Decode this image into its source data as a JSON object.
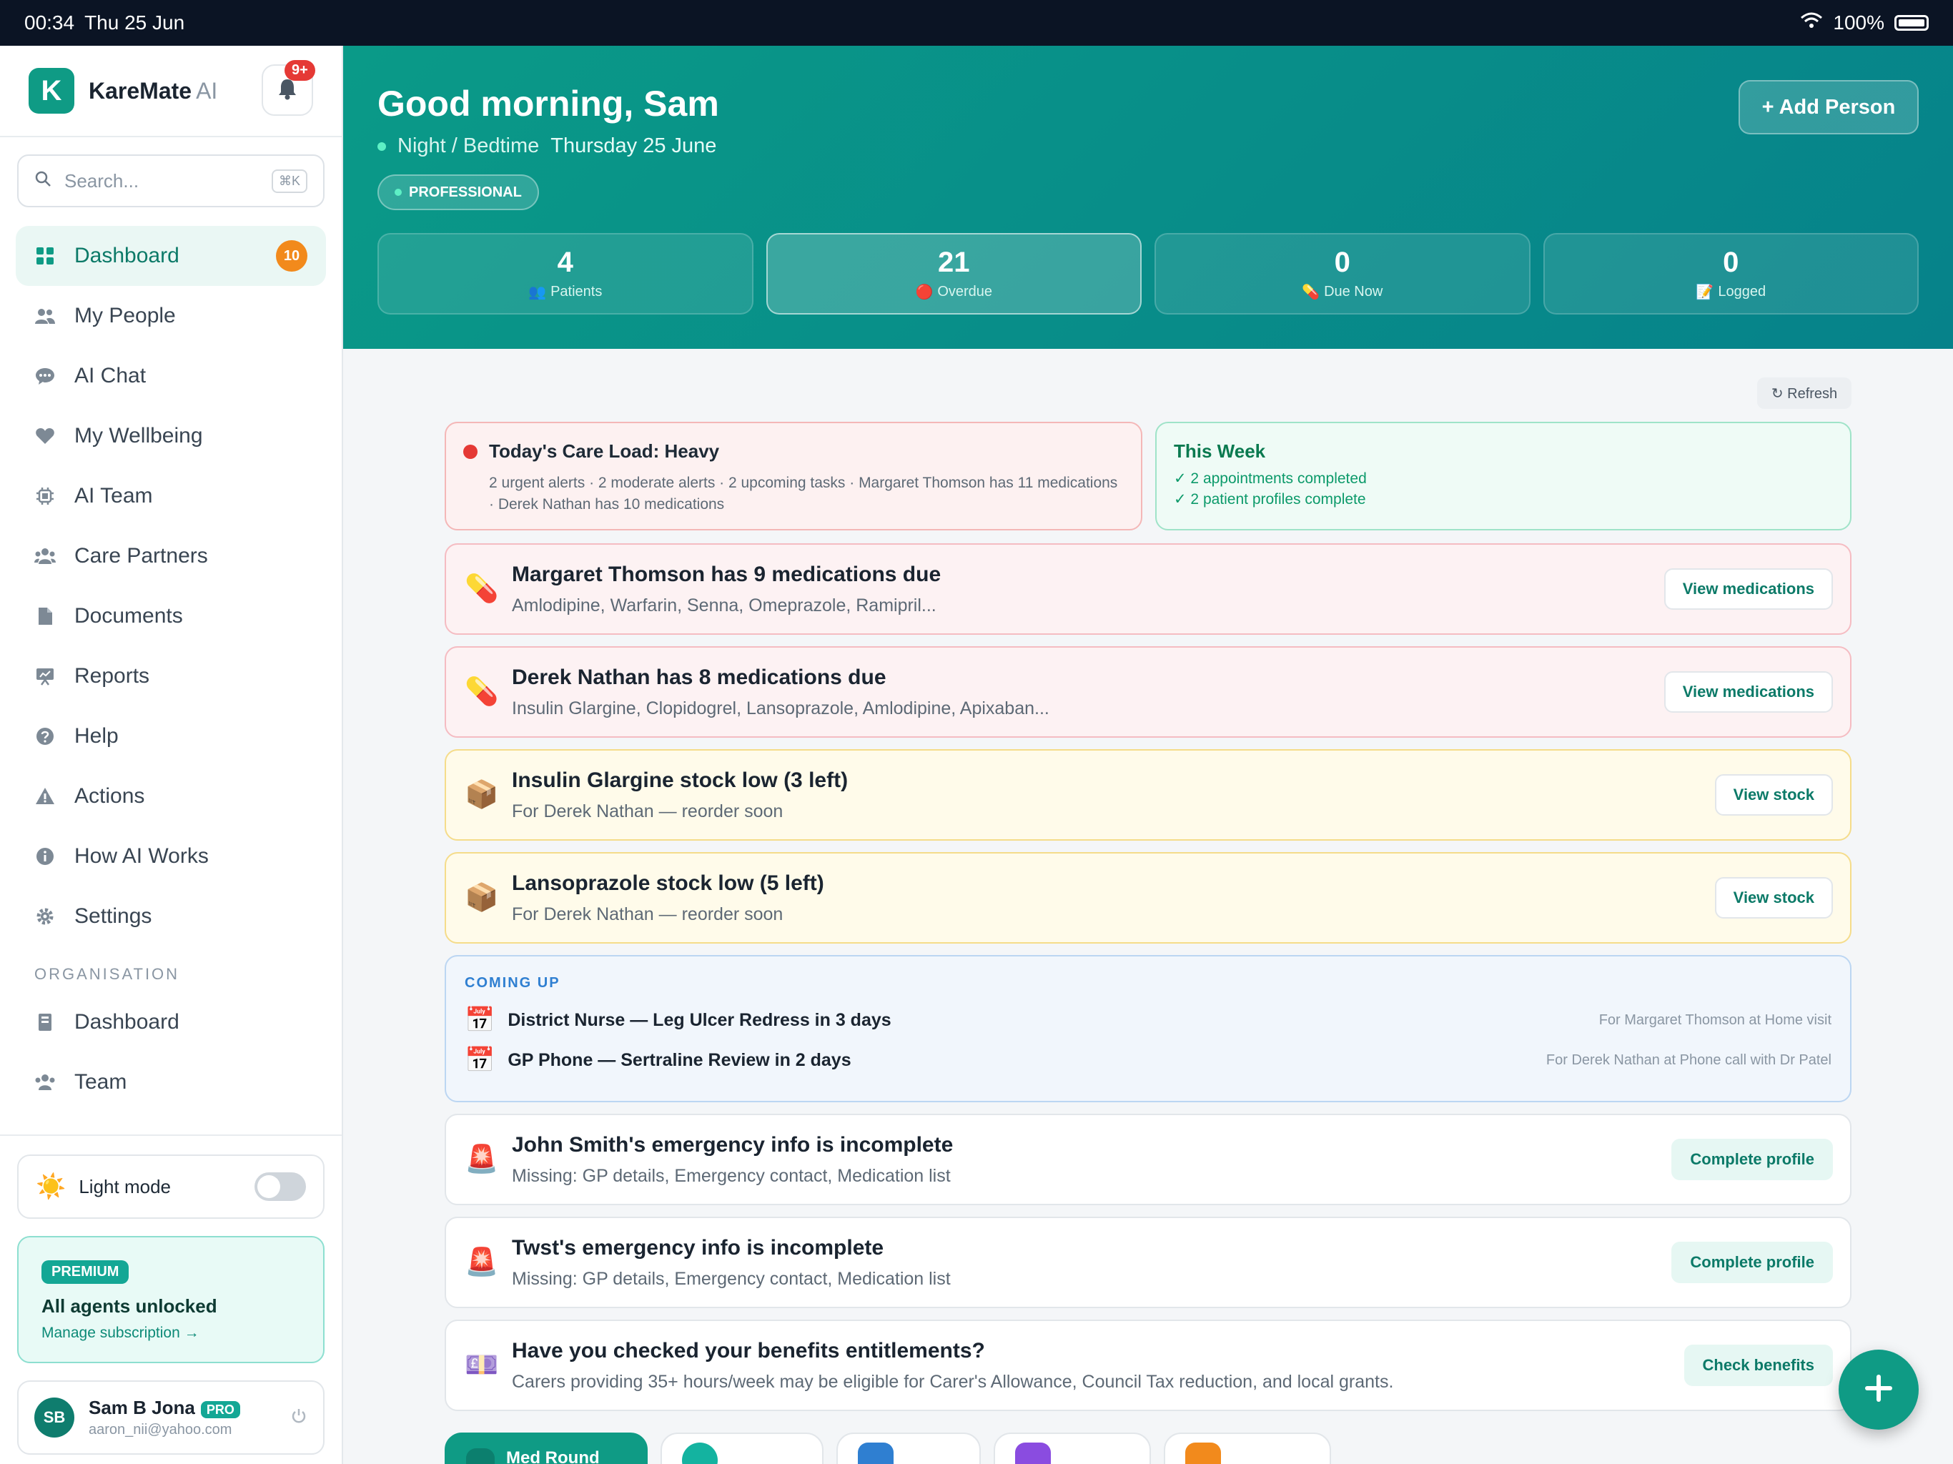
{
  "status_bar": {
    "time": "00:34",
    "date": "Thu 25 Jun",
    "battery": "100%"
  },
  "brand": {
    "name": "KareMate",
    "suffix": "AI",
    "logo_letter": "K",
    "notifications": "9+"
  },
  "search": {
    "placeholder": "Search...",
    "shortcut": "⌘K"
  },
  "nav": {
    "items": [
      {
        "label": "Dashboard",
        "icon": "grid-icon",
        "badge": "10"
      },
      {
        "label": "My People",
        "icon": "people-icon"
      },
      {
        "label": "AI Chat",
        "icon": "chat-icon"
      },
      {
        "label": "My Wellbeing",
        "icon": "heart-icon"
      },
      {
        "label": "AI Team",
        "icon": "chip-icon"
      },
      {
        "label": "Care Partners",
        "icon": "group-icon"
      },
      {
        "label": "Documents",
        "icon": "document-icon"
      },
      {
        "label": "Reports",
        "icon": "presentation-icon"
      },
      {
        "label": "Help",
        "icon": "question-icon"
      },
      {
        "label": "Actions",
        "icon": "warning-icon"
      },
      {
        "label": "How AI Works",
        "icon": "info-icon"
      },
      {
        "label": "Settings",
        "icon": "gear-icon"
      }
    ],
    "org_section": "ORGANISATION",
    "org_items": [
      {
        "label": "Dashboard",
        "icon": "building-icon"
      },
      {
        "label": "Team",
        "icon": "group-icon"
      }
    ]
  },
  "sidebar_footer": {
    "light_mode": "Light mode",
    "light_mode_on": false,
    "premium_badge": "PREMIUM",
    "premium_title": "All agents unlocked",
    "premium_link": "Manage subscription →",
    "user_initials": "SB",
    "user_name": "Sam B Jona",
    "user_badge": "PRO",
    "user_email": "aaron_nii@yahoo.com"
  },
  "header": {
    "greeting": "Good morning, Sam",
    "period": "Night / Bedtime",
    "date": "Thursday 25 June",
    "role_badge": "PROFESSIONAL",
    "add_person": "+ Add Person"
  },
  "stats": [
    {
      "value": "4",
      "label": "Patients",
      "emoji": "👥"
    },
    {
      "value": "21",
      "label": "Overdue",
      "emoji": "🔴"
    },
    {
      "value": "0",
      "label": "Due Now",
      "emoji": "💊"
    },
    {
      "value": "0",
      "label": "Logged",
      "emoji": "📝"
    }
  ],
  "refresh_label": "↻ Refresh",
  "care_load": {
    "title": "Today's Care Load: Heavy",
    "detail": "2 urgent alerts · 2 moderate alerts · 2 upcoming tasks · Margaret Thomson has 11 medications · Derek Nathan has 10 medications"
  },
  "this_week": {
    "title": "This Week",
    "items": [
      "✓ 2 appointments completed",
      "✓ 2 patient profiles complete"
    ]
  },
  "alerts_top": [
    {
      "emoji": "💊",
      "title": "Margaret Thomson has 9 medications due",
      "sub": "Amlodipine, Warfarin, Senna, Omeprazole, Ramipril...",
      "button": "View medications"
    },
    {
      "emoji": "💊",
      "title": "Derek Nathan has 8 medications due",
      "sub": "Insulin Glargine, Clopidogrel, Lansoprazole, Amlodipine, Apixaban...",
      "button": "View medications"
    },
    {
      "emoji": "📦",
      "title": "Insulin Glargine stock low (3 left)",
      "sub": "For Derek Nathan — reorder soon",
      "button": "View stock"
    },
    {
      "emoji": "📦",
      "title": "Lansoprazole stock low (5 left)",
      "sub": "For Derek Nathan — reorder soon",
      "button": "View stock"
    }
  ],
  "coming_up": {
    "heading": "COMING UP",
    "items": [
      {
        "emoji": "📅",
        "title": "District Nurse — Leg Ulcer Redress in 3 days",
        "detail": "For Margaret Thomson at Home visit"
      },
      {
        "emoji": "📅",
        "title": "GP Phone — Sertraline Review in 2 days",
        "detail": "For Derek Nathan at Phone call with Dr Patel"
      }
    ]
  },
  "alerts_bottom": [
    {
      "emoji": "🚨",
      "title": "John Smith's emergency info is incomplete",
      "sub": "Missing: GP details, Emergency contact, Medication list",
      "button": "Complete profile"
    },
    {
      "emoji": "🚨",
      "title": "Twst's emergency info is incomplete",
      "sub": "Missing: GP details, Emergency contact, Medication list",
      "button": "Complete profile"
    },
    {
      "emoji": "💷",
      "title": "Have you checked your benefits entitlements?",
      "sub": "Carers providing 35+ hours/week may be eligible for Carer's Allowance, Council Tax reduction, and local grants.",
      "button": "Check benefits"
    }
  ],
  "bottom_tabs": [
    {
      "label": "Med Round",
      "color": "#0f9b85"
    },
    {
      "label": "",
      "color": "#14b3a0"
    },
    {
      "label": "",
      "color": "#2f7fd1"
    },
    {
      "label": "",
      "color": "#8a4ce0"
    },
    {
      "label": "",
      "color": "#f28a1c"
    }
  ],
  "colors": {
    "accent": "#0f9b85",
    "alert_red": "#e53935",
    "badge_orange": "#f28a1c"
  }
}
